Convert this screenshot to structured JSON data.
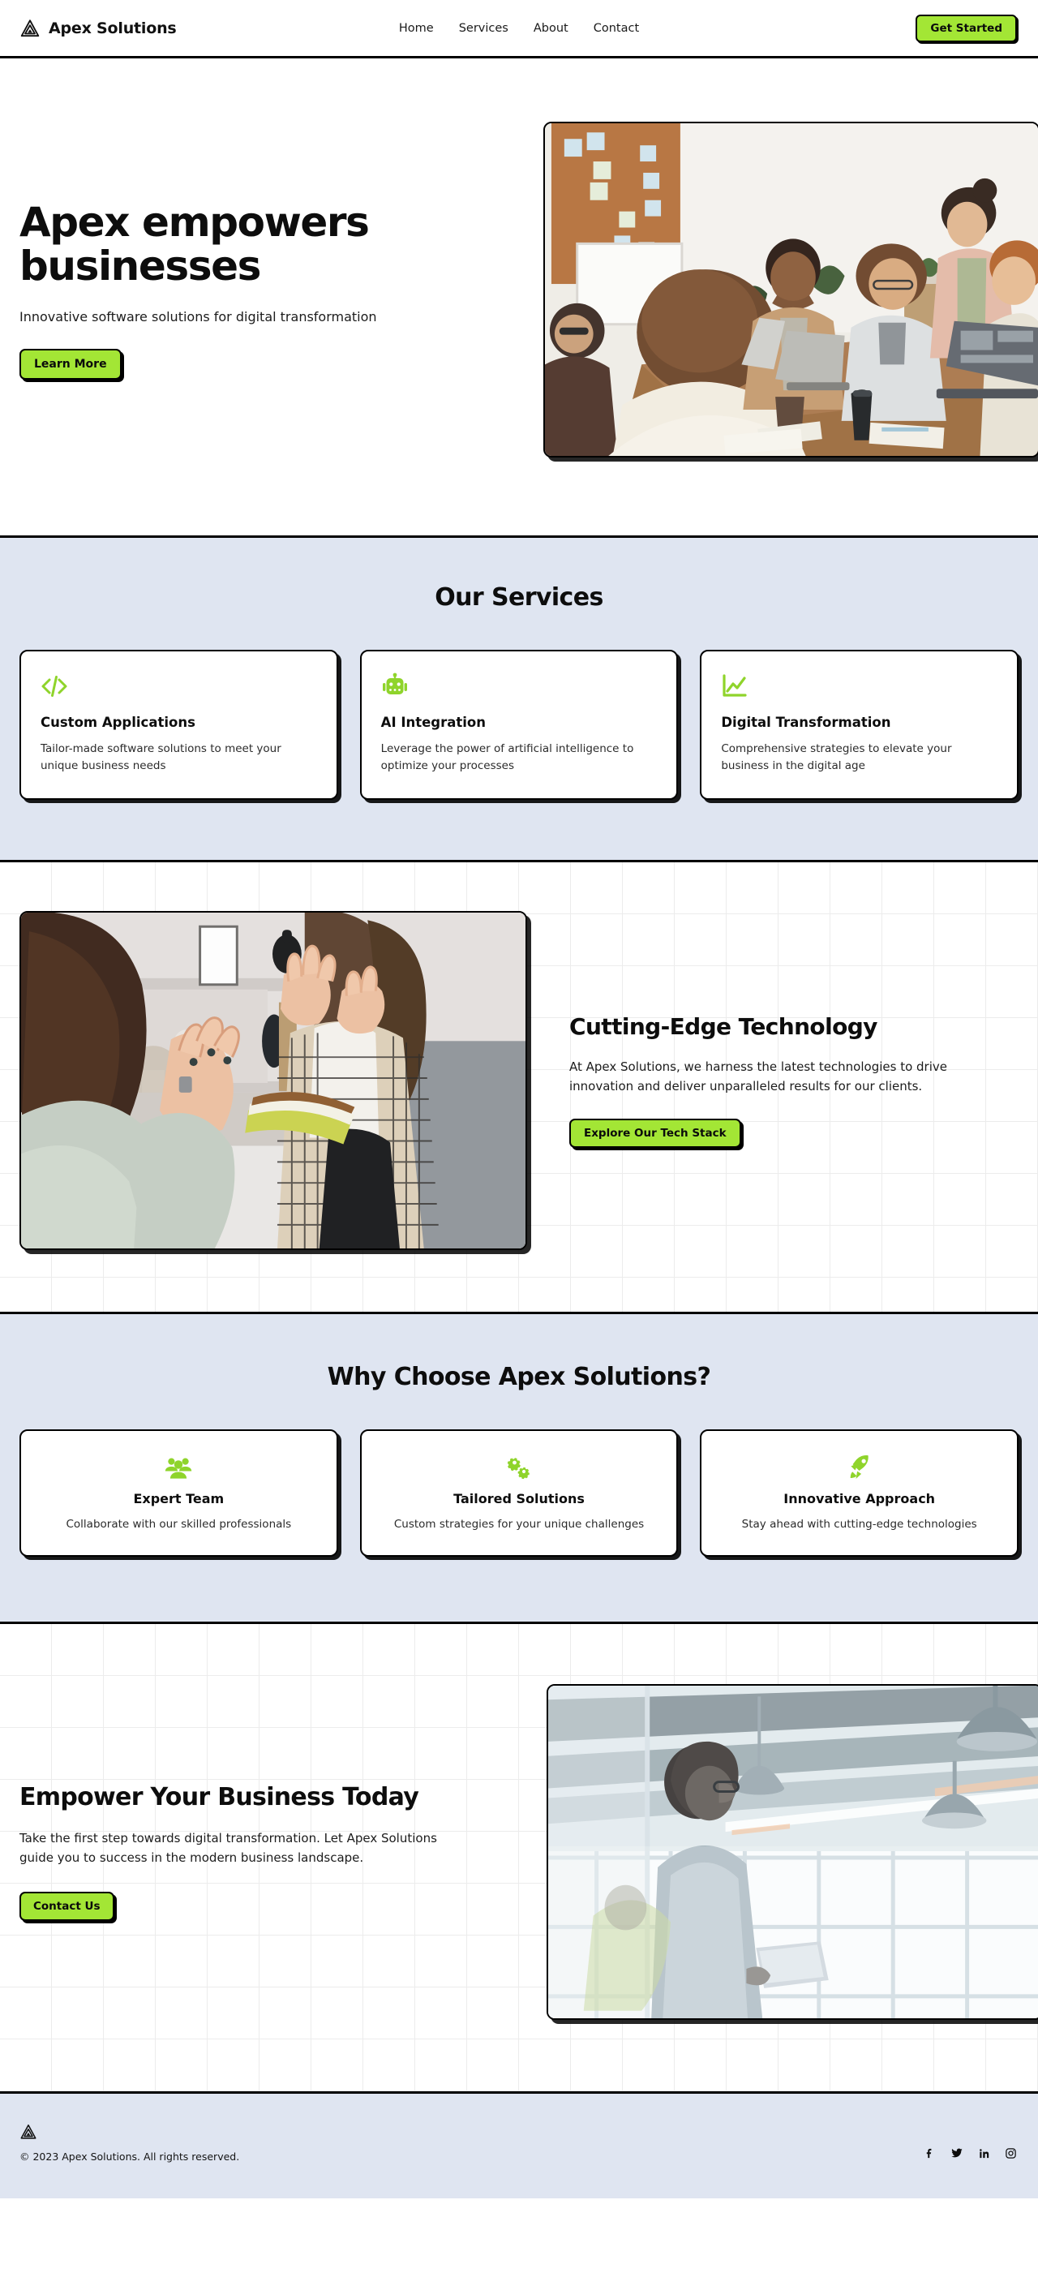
{
  "brand": {
    "name": "Apex Solutions",
    "logo_icon": "apex-triangle-icon"
  },
  "header": {
    "nav": [
      {
        "label": "Home"
      },
      {
        "label": "Services"
      },
      {
        "label": "About"
      },
      {
        "label": "Contact"
      }
    ],
    "cta_label": "Get Started"
  },
  "hero": {
    "title": "Apex empowers businesses",
    "subtitle": "Innovative software solutions for digital transformation",
    "cta_label": "Learn More",
    "image_alt": "team-meeting-photo"
  },
  "services": {
    "title": "Our Services",
    "cards": [
      {
        "icon": "code-brackets-icon",
        "title": "Custom Applications",
        "text": "Tailor-made software solutions to meet your unique business needs"
      },
      {
        "icon": "robot-icon",
        "title": "AI Integration",
        "text": "Leverage the power of artificial intelligence to optimize your processes"
      },
      {
        "icon": "line-chart-icon",
        "title": "Digital Transformation",
        "text": "Comprehensive strategies to elevate your business in the digital age"
      }
    ]
  },
  "feature": {
    "title": "Cutting-Edge Technology",
    "text": "At Apex Solutions, we harness the latest technologies to drive innovation and deliver unparalleled results for our clients.",
    "cta_label": "Explore Our Tech Stack",
    "image_alt": "two-women-discussing-photo"
  },
  "why": {
    "title": "Why Choose Apex Solutions?",
    "cards": [
      {
        "icon": "users-group-icon",
        "title": "Expert Team",
        "text": "Collaborate with our skilled professionals"
      },
      {
        "icon": "gears-icon",
        "title": "Tailored Solutions",
        "text": "Custom strategies for your unique challenges"
      },
      {
        "icon": "rocket-icon",
        "title": "Innovative Approach",
        "text": "Stay ahead with cutting-edge technologies"
      }
    ]
  },
  "cta": {
    "title": "Empower Your Business Today",
    "text": "Take the first step towards digital transformation. Let Apex Solutions guide you to success in the modern business landscape.",
    "cta_label": "Contact Us",
    "image_alt": "man-with-tablet-in-office-photo"
  },
  "footer": {
    "copyright": "© 2023 Apex Solutions. All rights reserved.",
    "socials": [
      {
        "icon": "facebook-icon"
      },
      {
        "icon": "twitter-icon"
      },
      {
        "icon": "linkedin-icon"
      },
      {
        "icon": "instagram-icon"
      }
    ]
  },
  "colors": {
    "accent": "#a3e635",
    "icon_green": "#8fd42b",
    "tint": "#dfe5f1",
    "ink": "#000000"
  }
}
